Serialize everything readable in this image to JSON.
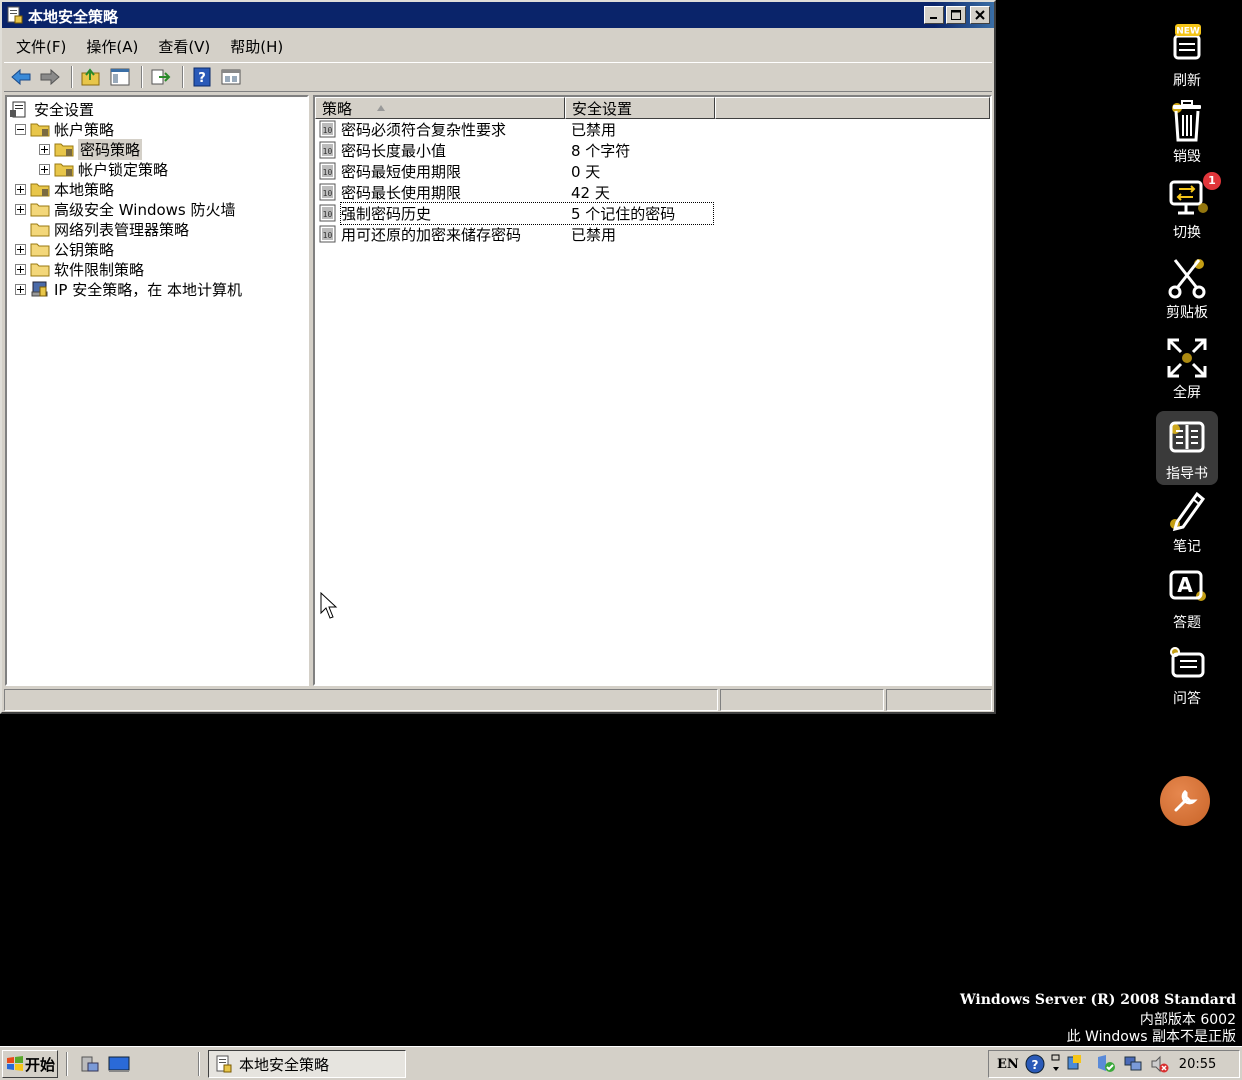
{
  "window": {
    "title": "本地安全策略",
    "controls": [
      "minimize-icon",
      "maximize-icon",
      "close-icon"
    ]
  },
  "menu": [
    "文件(F)",
    "操作(A)",
    "查看(V)",
    "帮助(H)"
  ],
  "toolbar": [
    "back-arrow-icon",
    "forward-arrow-icon",
    "up-folder-icon",
    "show-hide-tree-icon",
    "export-list-icon",
    "help-icon",
    "properties-view-icon"
  ],
  "tree": {
    "root": "安全设置",
    "items": [
      {
        "label": "帐户策略",
        "expander": "minus",
        "level": 1
      },
      {
        "label": "密码策略",
        "expander": "plus",
        "level": 2,
        "selected": true
      },
      {
        "label": "帐户锁定策略",
        "expander": "plus",
        "level": 2
      },
      {
        "label": "本地策略",
        "expander": "plus",
        "level": 1
      },
      {
        "label": "高级安全 Windows 防火墙",
        "expander": "plus",
        "level": 1
      },
      {
        "label": "网络列表管理器策略",
        "expander": "none",
        "level": 1
      },
      {
        "label": "公钥策略",
        "expander": "plus",
        "level": 1
      },
      {
        "label": "软件限制策略",
        "expander": "plus",
        "level": 1
      },
      {
        "label": "IP 安全策略，在 本地计算机",
        "expander": "plus",
        "level": 1
      }
    ]
  },
  "list": {
    "columns": [
      "策略",
      "安全设置"
    ],
    "rows": [
      {
        "policy": "密码必须符合复杂性要求",
        "setting": "已禁用"
      },
      {
        "policy": "密码长度最小值",
        "setting": "8 个字符"
      },
      {
        "policy": "密码最短使用期限",
        "setting": "0 天"
      },
      {
        "policy": "密码最长使用期限",
        "setting": "42 天"
      },
      {
        "policy": "强制密码历史",
        "setting": "5 个记住的密码"
      },
      {
        "policy": "用可还原的加密来储存密码",
        "setting": "已禁用"
      }
    ]
  },
  "side_panel": {
    "items": [
      {
        "label": "刷新",
        "icon": "new-refresh-icon"
      },
      {
        "label": "销毁",
        "icon": "trash-icon"
      },
      {
        "label": "切换",
        "icon": "switch-monitor-icon",
        "badge": "1"
      },
      {
        "label": "剪贴板",
        "icon": "scissors-icon"
      },
      {
        "label": "全屏",
        "icon": "fullscreen-icon"
      },
      {
        "label": "指导书",
        "icon": "book-icon",
        "active": true
      },
      {
        "label": "笔记",
        "icon": "pencil-icon"
      },
      {
        "label": "答题",
        "icon": "answer-icon"
      },
      {
        "label": "问答",
        "icon": "qa-icon"
      }
    ]
  },
  "watermark": {
    "line1": "Windows Server (R) 2008 Standard",
    "line2": "内部版本 6002",
    "line3": "此 Windows 副本不是正版"
  },
  "taskbar": {
    "start": "开始",
    "task": "本地安全策略",
    "lang": "EN",
    "clock": "20:55"
  },
  "colors": {
    "titlebar": "#0a246a",
    "face": "#d4d0c8",
    "wrench": "#d9743a"
  }
}
